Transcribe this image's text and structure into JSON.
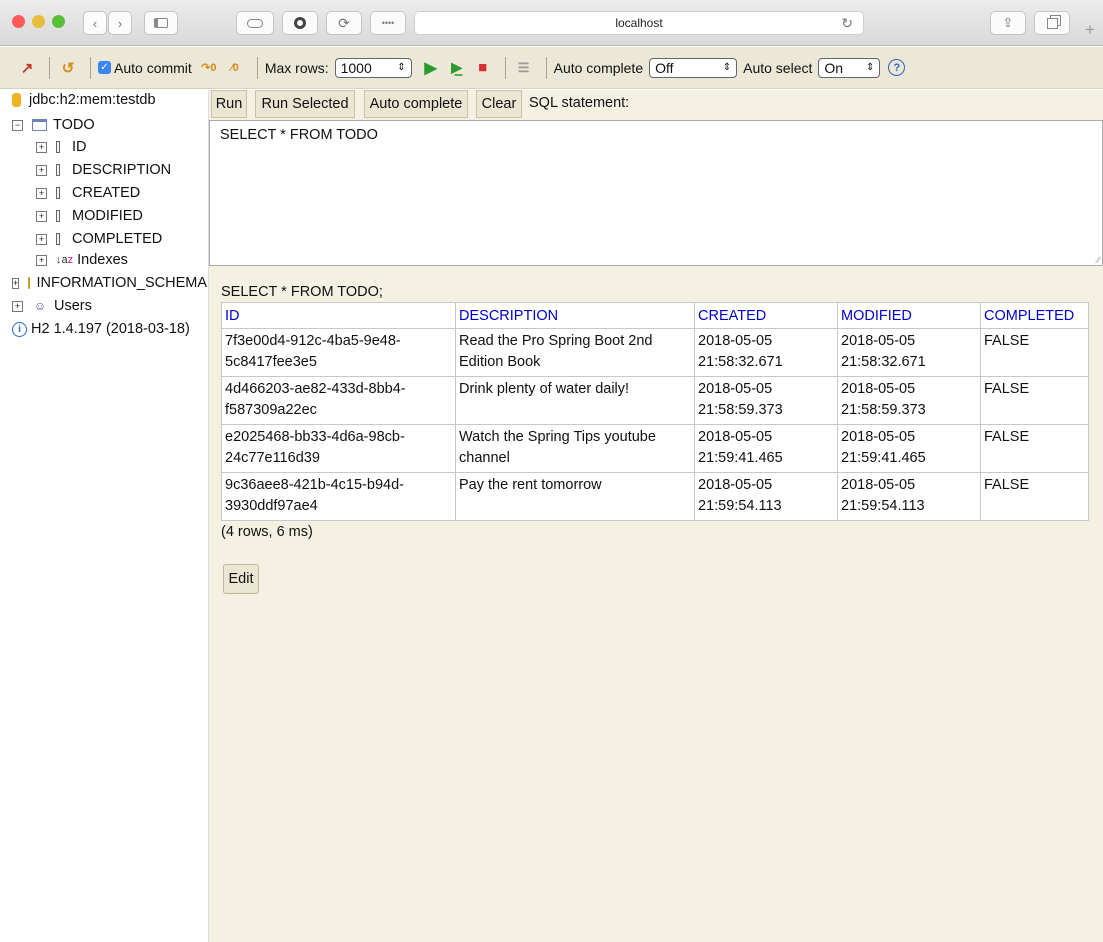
{
  "browser": {
    "url": "localhost",
    "colors": {
      "close": "#fc5b57",
      "minimize": "#e5bf3c",
      "maximize": "#57c038"
    }
  },
  "toolbar": {
    "auto_commit_label": "Auto commit",
    "max_rows_label": "Max rows:",
    "max_rows_value": "1000",
    "auto_complete_label": "Auto complete",
    "auto_complete_value": "Off",
    "auto_select_label": "Auto select",
    "auto_select_value": "On"
  },
  "tree": {
    "connection": "jdbc:h2:mem:testdb",
    "table": "TODO",
    "columns": [
      "ID",
      "DESCRIPTION",
      "CREATED",
      "MODIFIED",
      "COMPLETED"
    ],
    "indexes": "Indexes",
    "info_schema": "INFORMATION_SCHEMA",
    "users": "Users",
    "version": "H2 1.4.197 (2018-03-18)"
  },
  "buttons": {
    "run": "Run",
    "run_selected": "Run Selected",
    "auto_complete": "Auto complete",
    "clear": "Clear",
    "sql_statement_label": "SQL statement:",
    "edit": "Edit"
  },
  "sql": "SELECT * FROM TODO",
  "result": {
    "statement": "SELECT * FROM TODO;",
    "headers": [
      "ID",
      "DESCRIPTION",
      "CREATED",
      "MODIFIED",
      "COMPLETED"
    ],
    "rows": [
      {
        "id": [
          "7f3e00d4-912c-4ba5-9e48-",
          "5c8417fee3e5"
        ],
        "description": [
          "Read the Pro Spring Boot 2nd",
          "Edition Book"
        ],
        "created": [
          "2018-05-05",
          "21:58:32.671"
        ],
        "modified": [
          "2018-05-05",
          "21:58:32.671"
        ],
        "completed": "FALSE"
      },
      {
        "id": [
          "4d466203-ae82-433d-8bb4-",
          "f587309a22ec"
        ],
        "description": [
          "Drink plenty of water daily!",
          ""
        ],
        "created": [
          "2018-05-05",
          "21:58:59.373"
        ],
        "modified": [
          "2018-05-05",
          "21:58:59.373"
        ],
        "completed": "FALSE"
      },
      {
        "id": [
          "e2025468-bb33-4d6a-98cb-",
          "24c77e116d39"
        ],
        "description": [
          "Watch the Spring Tips youtube",
          "channel"
        ],
        "created": [
          "2018-05-05",
          "21:59:41.465"
        ],
        "modified": [
          "2018-05-05",
          "21:59:41.465"
        ],
        "completed": "FALSE"
      },
      {
        "id": [
          "9c36aee8-421b-4c15-b94d-",
          "3930ddf97ae4"
        ],
        "description": [
          "Pay the rent tomorrow",
          ""
        ],
        "created": [
          "2018-05-05",
          "21:59:54.113"
        ],
        "modified": [
          "2018-05-05",
          "21:59:54.113"
        ],
        "completed": "FALSE"
      }
    ],
    "row_count": "(4 rows, 6 ms)"
  }
}
